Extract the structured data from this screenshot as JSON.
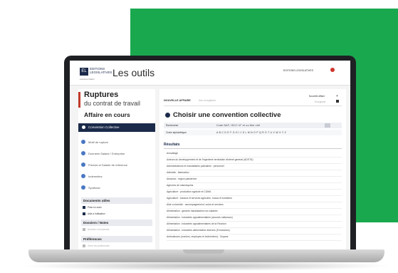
{
  "header": {
    "logo_mark": "EL",
    "logo_name": "EDITIONS LEGISLATIVES",
    "logo_tagline": "Lefebvre Dalloz",
    "app_title": "Les outils",
    "top_link": "EDITIONS LEGISLATIVES"
  },
  "sidebar": {
    "title": "Ruptures",
    "subtitle": "du contrat de travail",
    "section": "Affaire en cours",
    "active_item": "Convention Collective",
    "items": [
      {
        "label": "Motif de rupture"
      },
      {
        "label": "Donnees Salarie / Entreprise"
      },
      {
        "label": "Preavis et Salaire de reference"
      },
      {
        "label": "Indemnites"
      },
      {
        "label": "Synthese"
      }
    ],
    "docs_title": "Documents utiles",
    "docs": [
      {
        "label": "Prise en main"
      },
      {
        "label": "Aide a l'utilisation"
      }
    ],
    "dossiers_title": "Dossiers / Notes",
    "dossiers_item": "Acceder a l'ensemble",
    "prefs_title": "Préférences",
    "prefs_item": "Gerer les preferences"
  },
  "main": {
    "case_label": "NOUVELLE AFFAIRE",
    "case_hint": "Non enregistree",
    "new_case_link": "Nouvelle affaire",
    "save_link": "Enregistrer",
    "heading": "Choisir une convention collective",
    "search_label": "Rechercher",
    "search_value": "Code NAF, IDCC N° et ou Mot clef",
    "alpha_label": "Ordre alphabétique",
    "alphabet": "A B C D E F G H I J K L M N O P Q R S T U V W X Y Z",
    "results_title": "Résultats",
    "results": [
      "Avocatage",
      "Acteurs du developpement et de l'ingenierie territoriale d'interet general (ADITIG)",
      "Administrateurs et mandataires judiciaires : personnel",
      "Adhesifs : fabrication",
      "Aeraunic : region parisienne",
      "Agences de mannequins",
      "Agriculture : production agricole et CUMA",
      "Agriculture : travaux et services agricoles, ruraux et forestiers",
      "Aide a domicile : accompagnement, soins et services",
      "Alimentation : gerants mandataires non salaries",
      "Alimentation : industries agroalimentaires (accords nationaux)",
      "Alimentation : industries agroalimentaires de la Reunion",
      "Alimentation : industries alimentaires diverses (5 branches)",
      "Ambulances (ouvriers, employes et techniciens) : Guyane"
    ]
  },
  "colors": {
    "brand_navy": "#1b2a4a",
    "green": "#1aa84f",
    "accent_red": "#c0392b"
  }
}
